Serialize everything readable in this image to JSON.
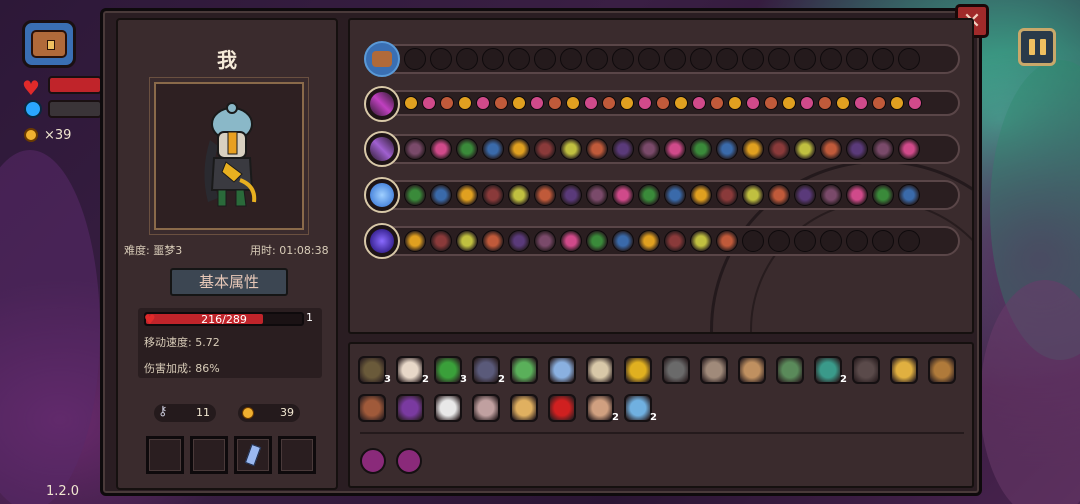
{
  "hud": {
    "coins_label": "×39",
    "version": "1.2.0"
  },
  "panel": {
    "close_label": "✕",
    "character": {
      "name": "我",
      "difficulty": "难度: 噩梦3",
      "elapsed": "用时: 01:08:38",
      "attr_tab": "基本属性",
      "hp_text": "216/289",
      "hp_fraction": 0.747,
      "hp_count": "1",
      "move_speed": "移动速度: 5.72",
      "damage_bonus": "伤害加成: 86%",
      "keys": "11",
      "coins": "39"
    },
    "item_counts": [
      "3",
      "2",
      "3",
      "2",
      "2",
      "2",
      "2"
    ]
  },
  "colors": {
    "hp_fill": "#c0242a",
    "panel_bg": "#2a1d22",
    "accent_gold": "#c9a86a"
  }
}
